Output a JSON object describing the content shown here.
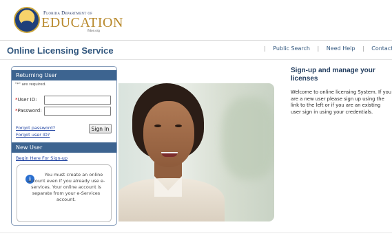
{
  "header": {
    "logo_line1": "Florida Department of",
    "logo_line2": "EDUCATION",
    "logo_line3": "fldoe.org"
  },
  "app_title": "Online Licensing Service",
  "top_nav": {
    "public_search": "Public Search",
    "need_help": "Need Help",
    "contact_us": "Contact Us"
  },
  "login": {
    "returning_heading": "Returning User",
    "required_note": "\"*\" are required.",
    "user_id_label": "User ID:",
    "password_label": "Password:",
    "user_id_value": "",
    "password_value": "",
    "forgot_password": "Forgot password?",
    "forgot_user_id": "Forgot user ID?",
    "sign_in": "Sign In"
  },
  "new_user": {
    "heading": "New User",
    "begin_link": "Begin Here For Sign-up",
    "note": "You must create an online account even if you already use e-services. Your online account is separate from your e-Services account."
  },
  "signup": {
    "title": "Sign-up and manage your licenses",
    "text": "Welcome to online licensing System. If you are a new user please sign up using the link to the left or if you are an existing user sign in using your credentials."
  },
  "icons": {
    "info": "info-icon",
    "seal": "state-seal-icon"
  },
  "colors": {
    "panel_header": "#3d6490",
    "title": "#33587f",
    "link": "#1b3fa0",
    "logo_gold": "#b8892c"
  }
}
